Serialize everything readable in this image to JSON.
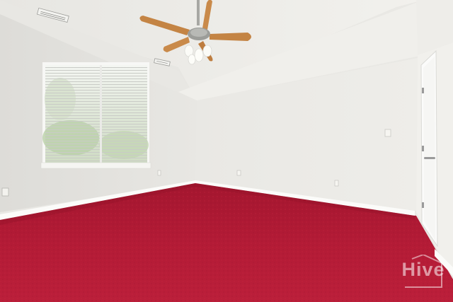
{
  "scene": {
    "description_type": "photo",
    "colors": {
      "ceiling": "#eeede9",
      "left_wall": "#e4e3df",
      "back_wall": "#ebeae6",
      "right_wall": "#efeeea",
      "carpet": "#b31a35",
      "trim": "#fafaf8",
      "fan_blade": "#c98a4a"
    }
  },
  "watermark": {
    "text": "Hive",
    "logo_icon": "hive-house-logo-icon"
  }
}
